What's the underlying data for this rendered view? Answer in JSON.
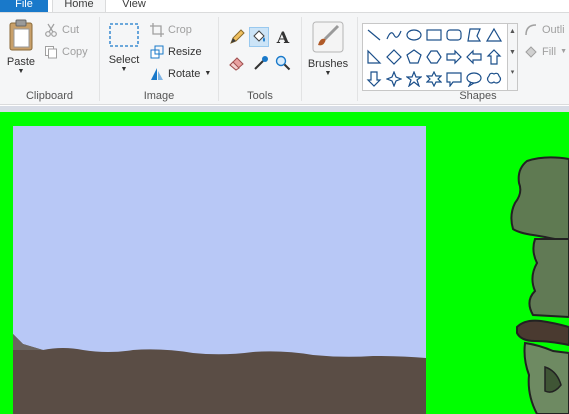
{
  "tabs": {
    "file": "File",
    "home": "Home",
    "view": "View"
  },
  "clipboard": {
    "paste": "Paste",
    "cut": "Cut",
    "copy": "Copy",
    "group_label": "Clipboard"
  },
  "image": {
    "select": "Select",
    "crop": "Crop",
    "resize": "Resize",
    "rotate": "Rotate",
    "group_label": "Image"
  },
  "tools": {
    "group_label": "Tools",
    "items": [
      "pencil-icon",
      "fill-icon",
      "text-icon",
      "eraser-icon",
      "color-picker-icon",
      "magnifier-icon"
    ],
    "active": "fill-icon"
  },
  "brushes": {
    "label": "Brushes"
  },
  "shapes": {
    "group_label": "Shapes",
    "outline": "Outli",
    "fill": "Fill"
  },
  "colors": {
    "workspace": "#00ff00",
    "canvas_sky": "#b8c8f6",
    "ground": "#5a4d45",
    "accent": "#1979ca"
  }
}
